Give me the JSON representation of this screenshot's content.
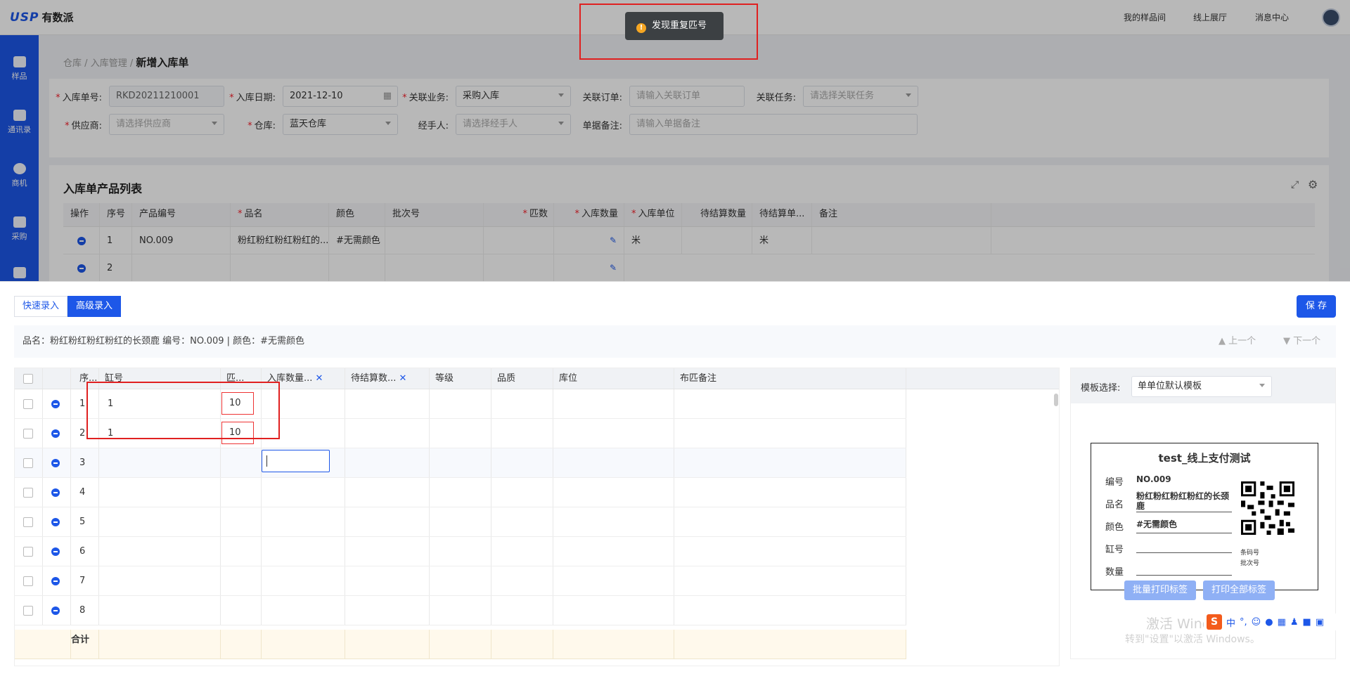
{
  "app": {
    "logo_usp": "USP",
    "logo_cn": "有数派"
  },
  "topnav": [
    "我的样品间",
    "线上展厅",
    "消息中心"
  ],
  "sidebar": [
    {
      "label": "样品"
    },
    {
      "label": "通讯录"
    },
    {
      "label": "商机"
    },
    {
      "label": "采购"
    }
  ],
  "breadcrumb": {
    "b1": "仓库",
    "sep": "/",
    "b2": "入库管理",
    "current": "新增入库单"
  },
  "form": {
    "order_no_label": "入库单号:",
    "order_no": "RKD20211210001",
    "date_label": "入库日期:",
    "date": "2021-12-10",
    "biz_label": "关联业务:",
    "biz": "采购入库",
    "order_label": "关联订单:",
    "order_ph": "请输入关联订单",
    "task_label": "关联任务:",
    "task_ph": "请选择关联任务",
    "supplier_label": "供应商:",
    "supplier_ph": "请选择供应商",
    "warehouse_label": "仓库:",
    "warehouse": "蓝天仓库",
    "handler_label": "经手人:",
    "handler_ph": "请选择经手人",
    "remark_label": "单据备注:",
    "remark_ph": "请输入单据备注"
  },
  "products": {
    "title": "入库单产品列表",
    "headers": [
      "操作",
      "序号",
      "产品编号",
      "品名",
      "颜色",
      "批次号",
      "匹数",
      "入库数量",
      "入库单位",
      "待结算数量",
      "待结算单...",
      "备注"
    ],
    "rows": [
      {
        "seq": "1",
        "code": "NO.009",
        "name": "粉红粉红粉红粉红的...",
        "color": "#无需颜色",
        "unit": "米",
        "unit2": "米"
      },
      {
        "seq": "2",
        "code": "",
        "name": "",
        "color": "",
        "unit": "",
        "unit2": ""
      }
    ]
  },
  "toast": {
    "icon": "!",
    "text": "发现重复匹号"
  },
  "panel": {
    "tab_quick": "快速录入",
    "tab_adv": "高级录入",
    "save": "保 存",
    "info": "品名：粉红粉红粉红粉红的长颈鹿   编号：NO.009   |   颜色：#无需颜色",
    "prev": "上一个",
    "next": "下一个",
    "headers": [
      "序...",
      "缸号",
      "匹...",
      "入库数量...",
      "待结算数...",
      "等级",
      "品质",
      "库位",
      "布匹备注"
    ],
    "rows": [
      {
        "seq": "1",
        "vat": "1",
        "pieces": "10"
      },
      {
        "seq": "2",
        "vat": "1",
        "pieces": "10"
      },
      {
        "seq": "3",
        "vat": "",
        "pieces": ""
      },
      {
        "seq": "4",
        "vat": "",
        "pieces": ""
      },
      {
        "seq": "5",
        "vat": "",
        "pieces": ""
      },
      {
        "seq": "6",
        "vat": "",
        "pieces": ""
      },
      {
        "seq": "7",
        "vat": "",
        "pieces": ""
      },
      {
        "seq": "8",
        "vat": "",
        "pieces": ""
      }
    ],
    "sum_label": "合计"
  },
  "template": {
    "select_label": "模板选择:",
    "select_value": "单单位默认模板",
    "label_title": "test_线上支付测试",
    "k_code": "编号",
    "v_code": "NO.009",
    "k_name": "品名",
    "v_name": "粉红粉红粉红粉红的长颈鹿",
    "k_color": "颜色",
    "v_color": "#无需颜色",
    "k_vat": "缸号",
    "k_qty": "数量",
    "qr_note1": "条码号",
    "qr_note2": "批次号",
    "btn_batch": "批量打印标签",
    "btn_all": "打印全部标签"
  },
  "watermark": {
    "line1": "激活 Windows",
    "line2": "转到\"设置\"以激活 Windows。"
  },
  "tray": {
    "ime": "中",
    "punct": "°,"
  }
}
